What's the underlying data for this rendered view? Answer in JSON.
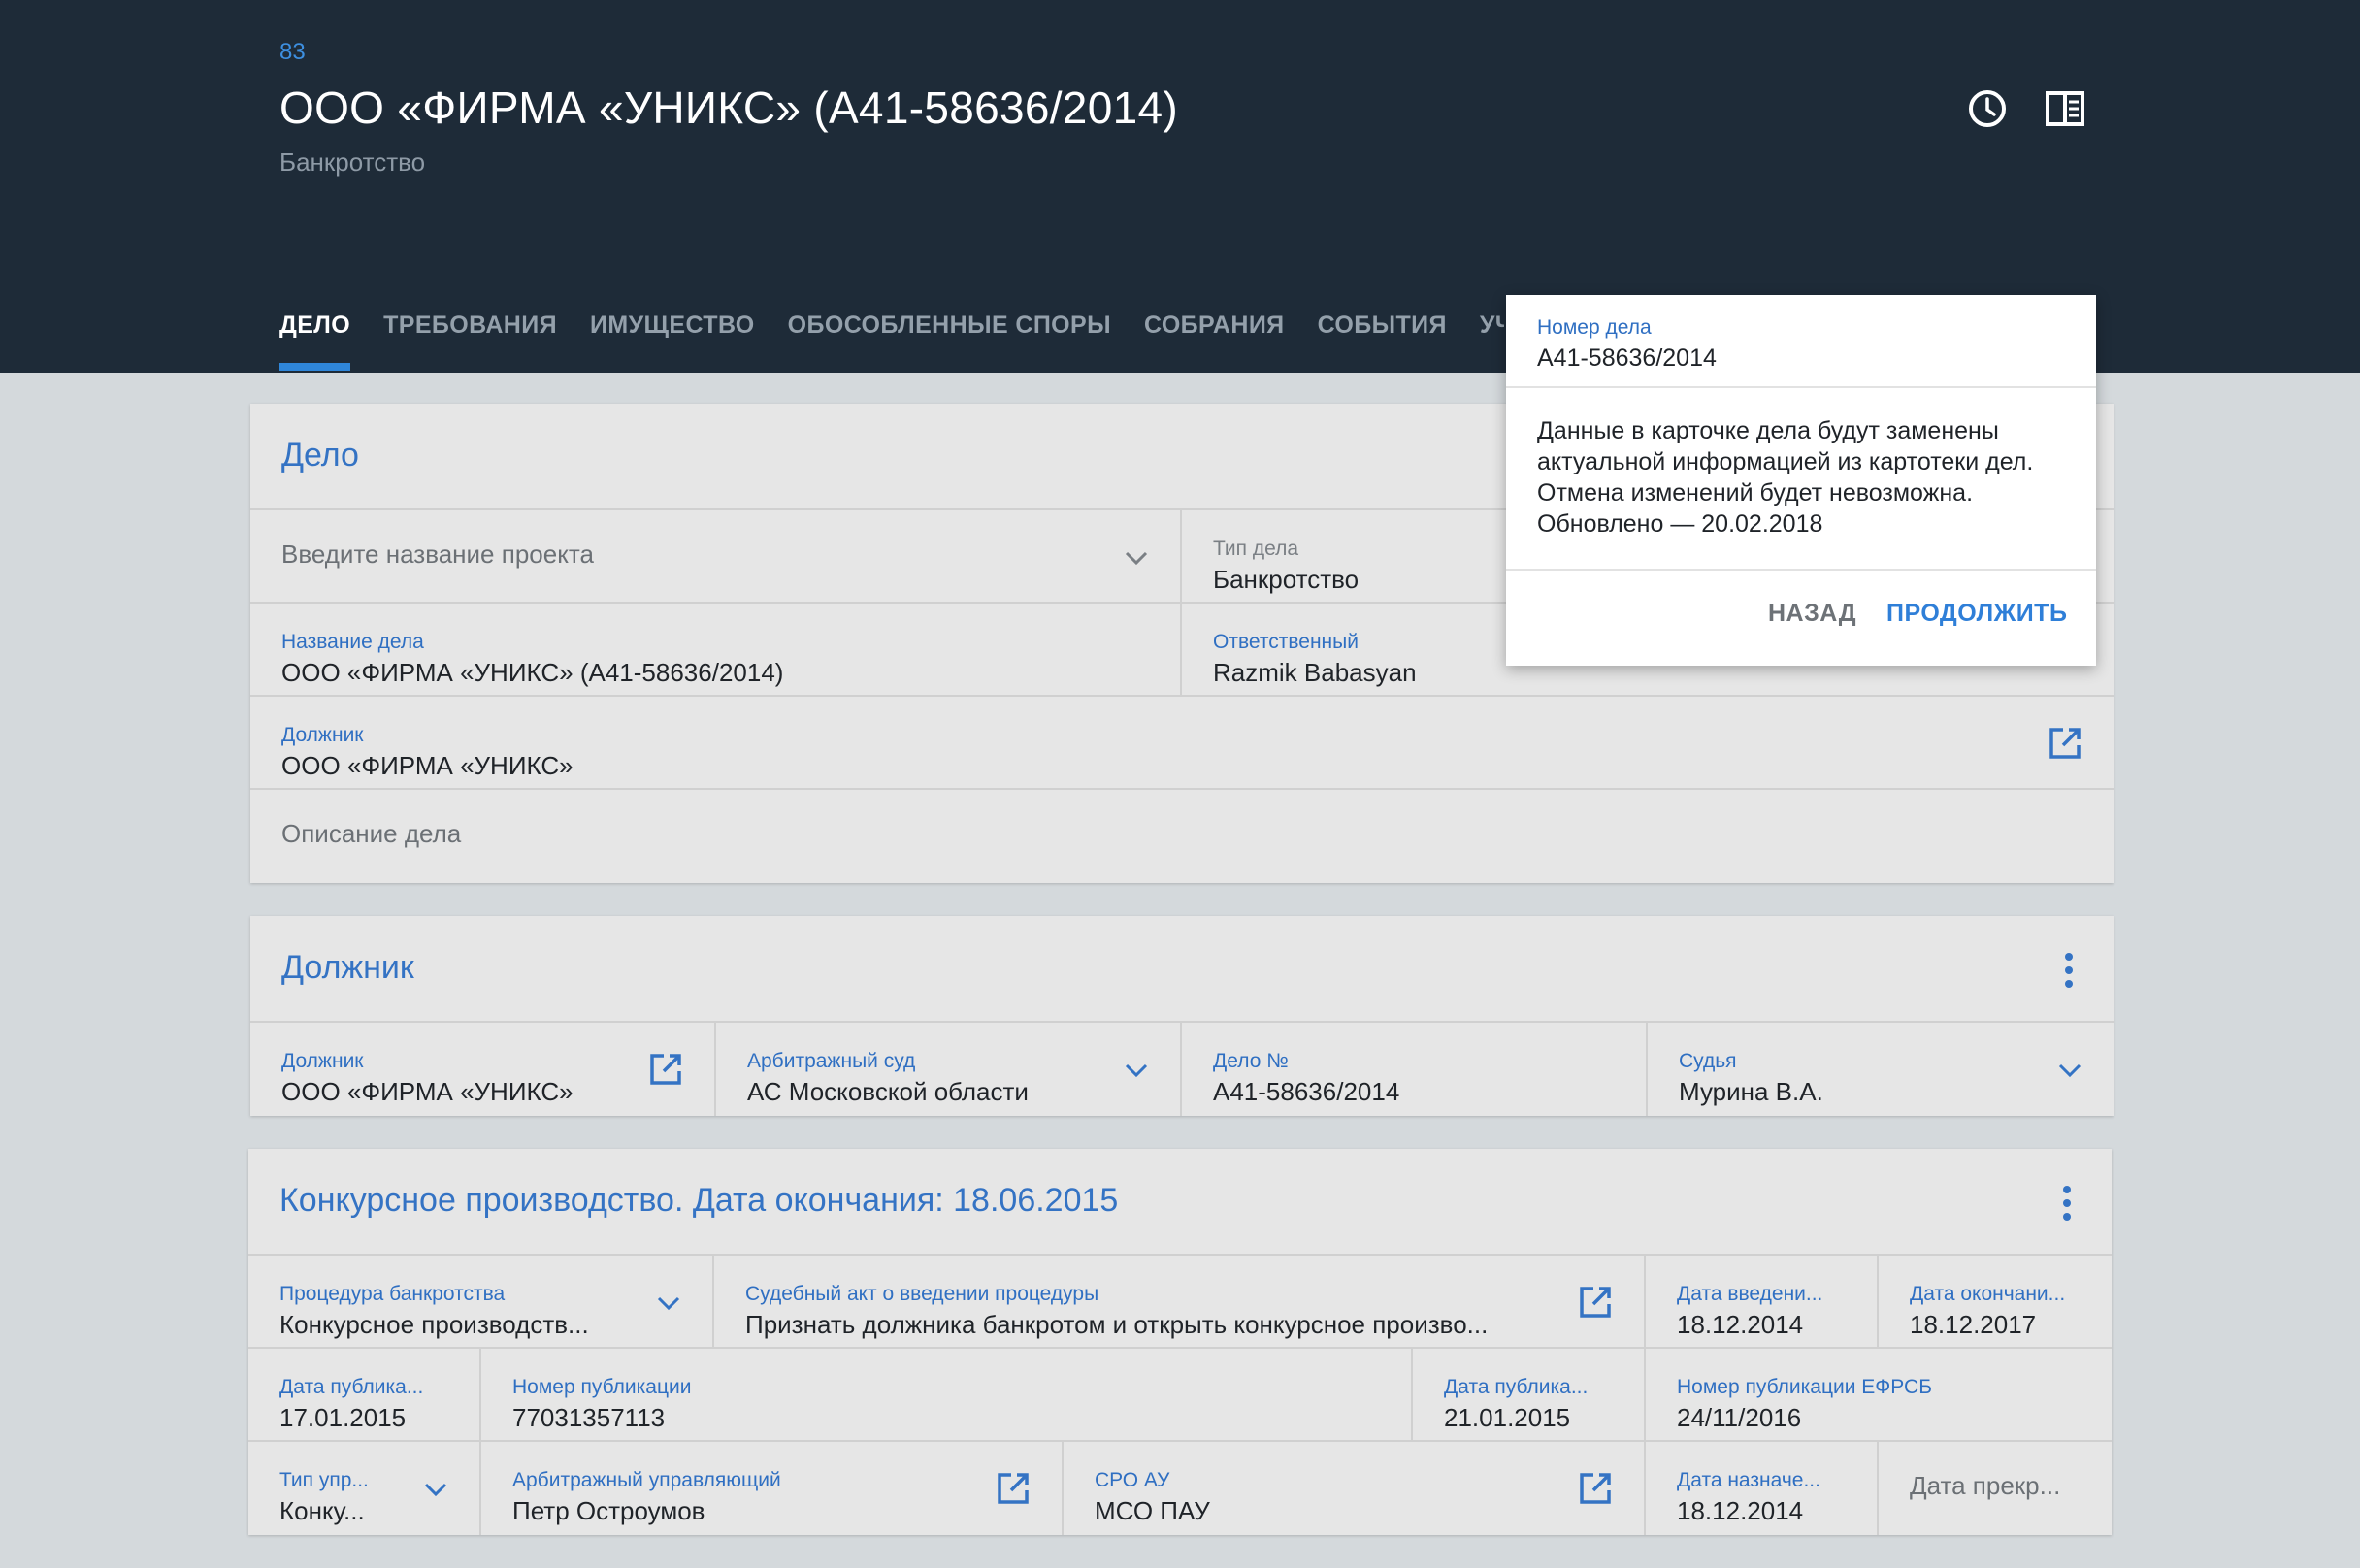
{
  "header": {
    "counter": "83",
    "title": "ООО «ФИРМА «УНИКС» (А41-58636/2014)",
    "subtitle": "Банкротство",
    "icons": [
      "history-icon",
      "side-panel-icon"
    ]
  },
  "tabs": [
    {
      "label": "ДЕЛО",
      "active": true
    },
    {
      "label": "ТРЕБОВАНИЯ"
    },
    {
      "label": "ИМУЩЕСТВО"
    },
    {
      "label": "ОБОСОБЛЕННЫЕ СПОРЫ"
    },
    {
      "label": "СОБРАНИЯ"
    },
    {
      "label": "СОБЫТИЯ"
    },
    {
      "label": "УЧАСТНИКИ"
    }
  ],
  "case_card": {
    "title": "Дело",
    "project_placeholder": "Введите название проекта",
    "case_type_label": "Тип дела",
    "case_type_value": "Банкротство",
    "case_name_label": "Название дела",
    "case_name_value": "ООО «ФИРМА «УНИКС» (А41-58636/2014)",
    "responsible_label": "Ответственный",
    "responsible_value": "Razmik Babasyan",
    "debtor_label": "Должник",
    "debtor_value": "ООО «ФИРМА «УНИКС»",
    "description_placeholder": "Описание дела"
  },
  "debtor_card": {
    "title": "Должник",
    "debtor_label": "Должник",
    "debtor_value": "ООО «ФИРМА «УНИКС»",
    "court_label": "Арбитражный суд",
    "court_value": "АС Московской области",
    "case_no_label": "Дело №",
    "case_no_value": "А41-58636/2014",
    "judge_label": "Судья",
    "judge_value": "Мурина В.А."
  },
  "procedure_card": {
    "title": "Конкурсное производство. Дата окончания: 18.06.2015",
    "procedure_label": "Процедура банкротства",
    "procedure_value": "Конкурсное производств...",
    "act_label": "Судебный акт о введении процедуры",
    "act_value": "Признать должника банкротом и открыть конкурсное произво...",
    "intro_date_label": "Дата введени...",
    "intro_date_value": "18.12.2014",
    "end_date_label": "Дата окончани...",
    "end_date_value": "18.12.2017",
    "pub_date1_label": "Дата публика...",
    "pub_date1_value": "17.01.2015",
    "pub_no_label": "Номер публикации",
    "pub_no_value": "77031357113",
    "pub_date2_label": "Дата публика...",
    "pub_date2_value": "21.01.2015",
    "efrsb_label": "Номер публикации ЕФРСБ",
    "efrsb_value": "24/11/2016",
    "mgmt_type_label": "Тип упр...",
    "mgmt_type_value": "Конку...",
    "manager_label": "Арбитражный управляющий",
    "manager_value": "Петр Остроумов",
    "sro_label": "СРО АУ",
    "sro_value": "МСО ПАУ",
    "appoint_label": "Дата назначе...",
    "appoint_value": "18.12.2014",
    "term_placeholder": "Дата прекр..."
  },
  "popup": {
    "label": "Номер дела",
    "value": "А41-58636/2014",
    "message_lines": [
      "Данные в карточке дела будут заменены",
      "актуальной информацией из картотеки дел.",
      "Отмена изменений будет невозможна.",
      "Обновлено — 20.02.2018"
    ],
    "back_label": "НАЗАД",
    "continue_label": "ПРОДОЛЖИТЬ"
  },
  "colors": {
    "header_bg": "#1e2b38",
    "accent": "#2f86d9",
    "label_blue": "#2f6fc2",
    "page_bg": "#d4d9dc",
    "card_bg": "#e6e6e6"
  }
}
